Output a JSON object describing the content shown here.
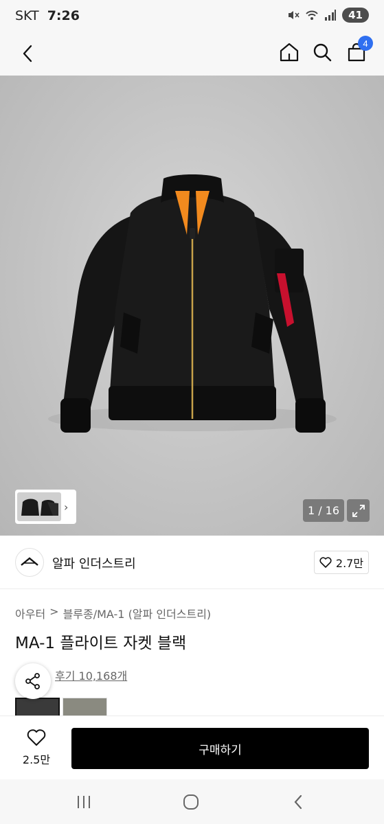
{
  "status_bar": {
    "carrier": "SKT",
    "time": "7:26",
    "battery": "41"
  },
  "header": {
    "cart_count": "4"
  },
  "gallery": {
    "counter": "1 / 16"
  },
  "brand": {
    "name": "알파 인더스트리",
    "likes": "2.7만",
    "logo_text": "ALPHA"
  },
  "breadcrumb": {
    "level1": "아우터",
    "separator": ">",
    "level2": "블루종/MA-1 (알파 인더스트리)"
  },
  "product": {
    "title": "MA-1 플라이트 자켓 블랙",
    "review_text": "후기 10,168개"
  },
  "actions": {
    "wish_count": "2.5만",
    "buy_label": "구매하기"
  },
  "colors": {
    "accent": "#2f6ff0",
    "primary_button": "#000000",
    "tag_red": "#c8102e",
    "lining_orange": "#f28a1e"
  }
}
